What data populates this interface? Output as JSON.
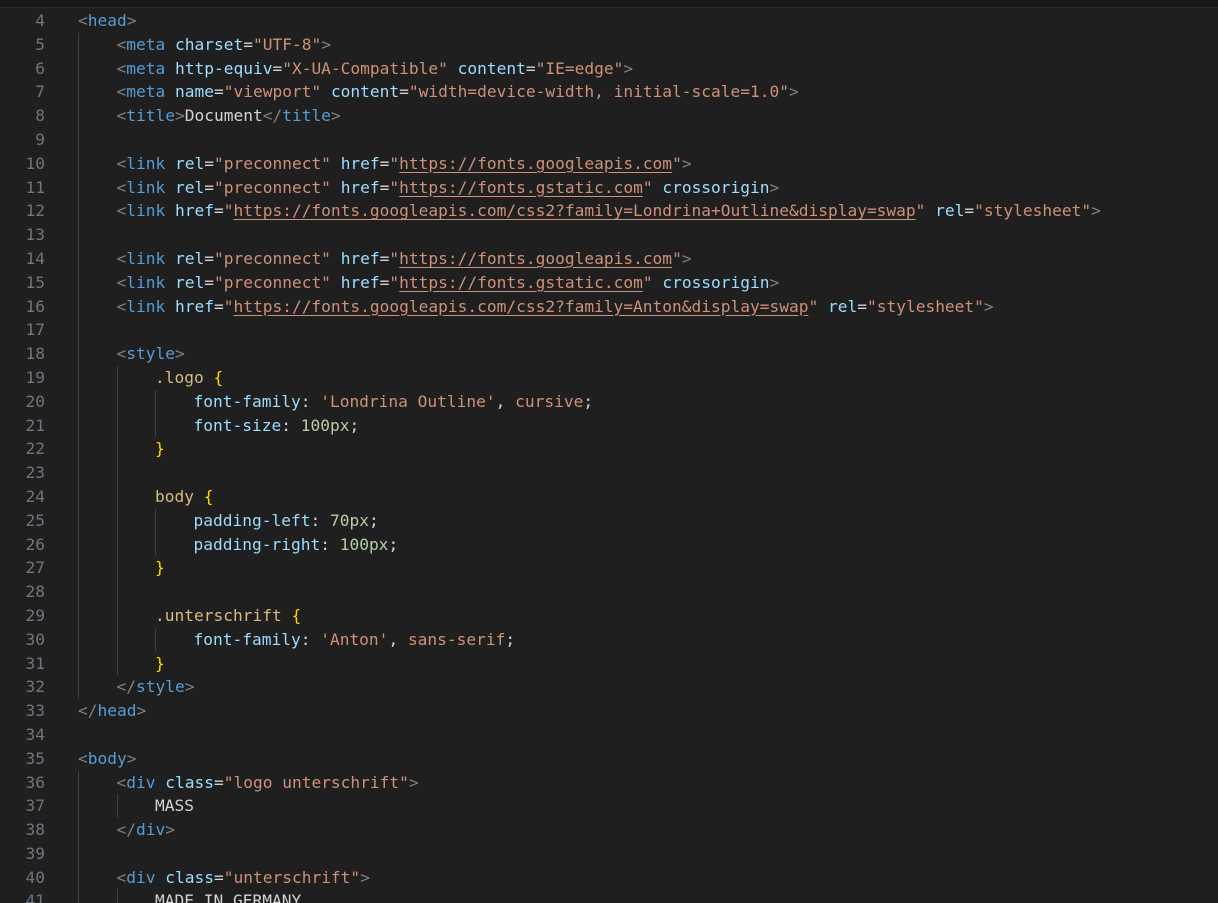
{
  "editor": {
    "language": "html",
    "lines": [
      {
        "n": "4",
        "indent": 0,
        "tokens": [
          [
            "br",
            "<"
          ],
          [
            "tag",
            "head"
          ],
          [
            "br",
            ">"
          ]
        ]
      },
      {
        "n": "5",
        "indent": 1,
        "tokens": [
          [
            "br",
            "<"
          ],
          [
            "tag",
            "meta"
          ],
          [
            "p",
            " "
          ],
          [
            "attr",
            "charset"
          ],
          [
            "p",
            "="
          ],
          [
            "str",
            "\"UTF-8\""
          ],
          [
            "br",
            ">"
          ]
        ]
      },
      {
        "n": "6",
        "indent": 1,
        "tokens": [
          [
            "br",
            "<"
          ],
          [
            "tag",
            "meta"
          ],
          [
            "p",
            " "
          ],
          [
            "attr",
            "http-equiv"
          ],
          [
            "p",
            "="
          ],
          [
            "str",
            "\"X-UA-Compatible\""
          ],
          [
            "p",
            " "
          ],
          [
            "attr",
            "content"
          ],
          [
            "p",
            "="
          ],
          [
            "str",
            "\"IE=edge\""
          ],
          [
            "br",
            ">"
          ]
        ]
      },
      {
        "n": "7",
        "indent": 1,
        "tokens": [
          [
            "br",
            "<"
          ],
          [
            "tag",
            "meta"
          ],
          [
            "p",
            " "
          ],
          [
            "attr",
            "name"
          ],
          [
            "p",
            "="
          ],
          [
            "str",
            "\"viewport\""
          ],
          [
            "p",
            " "
          ],
          [
            "attr",
            "content"
          ],
          [
            "p",
            "="
          ],
          [
            "str",
            "\"width=device-width, initial-scale=1.0\""
          ],
          [
            "br",
            ">"
          ]
        ]
      },
      {
        "n": "8",
        "indent": 1,
        "tokens": [
          [
            "br",
            "<"
          ],
          [
            "tag",
            "title"
          ],
          [
            "br",
            ">"
          ],
          [
            "txt",
            "Document"
          ],
          [
            "br",
            "</"
          ],
          [
            "tag",
            "title"
          ],
          [
            "br",
            ">"
          ]
        ]
      },
      {
        "n": "9",
        "indent": 1,
        "tokens": []
      },
      {
        "n": "10",
        "indent": 1,
        "tokens": [
          [
            "br",
            "<"
          ],
          [
            "tag",
            "link"
          ],
          [
            "p",
            " "
          ],
          [
            "attr",
            "rel"
          ],
          [
            "p",
            "="
          ],
          [
            "str",
            "\"preconnect\""
          ],
          [
            "p",
            " "
          ],
          [
            "attr",
            "href"
          ],
          [
            "p",
            "="
          ],
          [
            "str",
            "\""
          ],
          [
            "url",
            "https://fonts.googleapis.com"
          ],
          [
            "str",
            "\""
          ],
          [
            "br",
            ">"
          ]
        ]
      },
      {
        "n": "11",
        "indent": 1,
        "tokens": [
          [
            "br",
            "<"
          ],
          [
            "tag",
            "link"
          ],
          [
            "p",
            " "
          ],
          [
            "attr",
            "rel"
          ],
          [
            "p",
            "="
          ],
          [
            "str",
            "\"preconnect\""
          ],
          [
            "p",
            " "
          ],
          [
            "attr",
            "href"
          ],
          [
            "p",
            "="
          ],
          [
            "str",
            "\""
          ],
          [
            "url",
            "https://fonts.gstatic.com"
          ],
          [
            "str",
            "\""
          ],
          [
            "p",
            " "
          ],
          [
            "attr",
            "crossorigin"
          ],
          [
            "br",
            ">"
          ]
        ]
      },
      {
        "n": "12",
        "indent": 1,
        "tokens": [
          [
            "br",
            "<"
          ],
          [
            "tag",
            "link"
          ],
          [
            "p",
            " "
          ],
          [
            "attr",
            "href"
          ],
          [
            "p",
            "="
          ],
          [
            "str",
            "\""
          ],
          [
            "url",
            "https://fonts.googleapis.com/css2?family=Londrina+Outline&display=swap"
          ],
          [
            "str",
            "\""
          ],
          [
            "p",
            " "
          ],
          [
            "attr",
            "rel"
          ],
          [
            "p",
            "="
          ],
          [
            "str",
            "\"stylesheet\""
          ],
          [
            "br",
            ">"
          ]
        ]
      },
      {
        "n": "13",
        "indent": 1,
        "tokens": []
      },
      {
        "n": "14",
        "indent": 1,
        "tokens": [
          [
            "br",
            "<"
          ],
          [
            "tag",
            "link"
          ],
          [
            "p",
            " "
          ],
          [
            "attr",
            "rel"
          ],
          [
            "p",
            "="
          ],
          [
            "str",
            "\"preconnect\""
          ],
          [
            "p",
            " "
          ],
          [
            "attr",
            "href"
          ],
          [
            "p",
            "="
          ],
          [
            "str",
            "\""
          ],
          [
            "url",
            "https://fonts.googleapis.com"
          ],
          [
            "str",
            "\""
          ],
          [
            "br",
            ">"
          ]
        ]
      },
      {
        "n": "15",
        "indent": 1,
        "tokens": [
          [
            "br",
            "<"
          ],
          [
            "tag",
            "link"
          ],
          [
            "p",
            " "
          ],
          [
            "attr",
            "rel"
          ],
          [
            "p",
            "="
          ],
          [
            "str",
            "\"preconnect\""
          ],
          [
            "p",
            " "
          ],
          [
            "attr",
            "href"
          ],
          [
            "p",
            "="
          ],
          [
            "str",
            "\""
          ],
          [
            "url",
            "https://fonts.gstatic.com"
          ],
          [
            "str",
            "\""
          ],
          [
            "p",
            " "
          ],
          [
            "attr",
            "crossorigin"
          ],
          [
            "br",
            ">"
          ]
        ]
      },
      {
        "n": "16",
        "indent": 1,
        "tokens": [
          [
            "br",
            "<"
          ],
          [
            "tag",
            "link"
          ],
          [
            "p",
            " "
          ],
          [
            "attr",
            "href"
          ],
          [
            "p",
            "="
          ],
          [
            "str",
            "\""
          ],
          [
            "url",
            "https://fonts.googleapis.com/css2?family=Anton&display=swap"
          ],
          [
            "str",
            "\""
          ],
          [
            "p",
            " "
          ],
          [
            "attr",
            "rel"
          ],
          [
            "p",
            "="
          ],
          [
            "str",
            "\"stylesheet\""
          ],
          [
            "br",
            ">"
          ]
        ]
      },
      {
        "n": "17",
        "indent": 1,
        "tokens": []
      },
      {
        "n": "18",
        "indent": 1,
        "tokens": [
          [
            "br",
            "<"
          ],
          [
            "tag",
            "style"
          ],
          [
            "br",
            ">"
          ]
        ]
      },
      {
        "n": "19",
        "indent": 2,
        "tokens": [
          [
            "sel",
            ".logo"
          ],
          [
            "p",
            " "
          ],
          [
            "brace",
            "{"
          ]
        ]
      },
      {
        "n": "20",
        "indent": 3,
        "tokens": [
          [
            "prop",
            "font-family"
          ],
          [
            "p",
            ": "
          ],
          [
            "val",
            "'Londrina Outline'"
          ],
          [
            "p",
            ", "
          ],
          [
            "val",
            "cursive"
          ],
          [
            "p",
            ";"
          ]
        ]
      },
      {
        "n": "21",
        "indent": 3,
        "tokens": [
          [
            "prop",
            "font-size"
          ],
          [
            "p",
            ": "
          ],
          [
            "num",
            "100px"
          ],
          [
            "p",
            ";"
          ]
        ]
      },
      {
        "n": "22",
        "indent": 2,
        "tokens": [
          [
            "brace",
            "}"
          ]
        ]
      },
      {
        "n": "23",
        "indent": 2,
        "tokens": []
      },
      {
        "n": "24",
        "indent": 2,
        "tokens": [
          [
            "sel",
            "body"
          ],
          [
            "p",
            " "
          ],
          [
            "brace",
            "{"
          ]
        ]
      },
      {
        "n": "25",
        "indent": 3,
        "tokens": [
          [
            "prop",
            "padding-left"
          ],
          [
            "p",
            ": "
          ],
          [
            "num",
            "70px"
          ],
          [
            "p",
            ";"
          ]
        ]
      },
      {
        "n": "26",
        "indent": 3,
        "tokens": [
          [
            "prop",
            "padding-right"
          ],
          [
            "p",
            ": "
          ],
          [
            "num",
            "100px"
          ],
          [
            "p",
            ";"
          ]
        ]
      },
      {
        "n": "27",
        "indent": 2,
        "tokens": [
          [
            "brace",
            "}"
          ]
        ]
      },
      {
        "n": "28",
        "indent": 2,
        "tokens": []
      },
      {
        "n": "29",
        "indent": 2,
        "tokens": [
          [
            "sel",
            ".unterschrift"
          ],
          [
            "p",
            " "
          ],
          [
            "brace",
            "{"
          ]
        ]
      },
      {
        "n": "30",
        "indent": 3,
        "tokens": [
          [
            "prop",
            "font-family"
          ],
          [
            "p",
            ": "
          ],
          [
            "val",
            "'Anton'"
          ],
          [
            "p",
            ", "
          ],
          [
            "val",
            "sans-serif"
          ],
          [
            "p",
            ";"
          ]
        ]
      },
      {
        "n": "31",
        "indent": 2,
        "tokens": [
          [
            "brace",
            "}"
          ]
        ]
      },
      {
        "n": "32",
        "indent": 1,
        "tokens": [
          [
            "br",
            "</"
          ],
          [
            "tag",
            "style"
          ],
          [
            "br",
            ">"
          ]
        ]
      },
      {
        "n": "33",
        "indent": 0,
        "tokens": [
          [
            "br",
            "</"
          ],
          [
            "tag",
            "head"
          ],
          [
            "br",
            ">"
          ]
        ]
      },
      {
        "n": "34",
        "indent": 0,
        "tokens": []
      },
      {
        "n": "35",
        "indent": 0,
        "tokens": [
          [
            "br",
            "<"
          ],
          [
            "tag",
            "body"
          ],
          [
            "br",
            ">"
          ]
        ]
      },
      {
        "n": "36",
        "indent": 1,
        "tokens": [
          [
            "br",
            "<"
          ],
          [
            "tag",
            "div"
          ],
          [
            "p",
            " "
          ],
          [
            "attr",
            "class"
          ],
          [
            "p",
            "="
          ],
          [
            "str",
            "\"logo unterschrift\""
          ],
          [
            "br",
            ">"
          ]
        ]
      },
      {
        "n": "37",
        "indent": 2,
        "tokens": [
          [
            "txt",
            "MASS"
          ]
        ]
      },
      {
        "n": "38",
        "indent": 1,
        "tokens": [
          [
            "br",
            "</"
          ],
          [
            "tag",
            "div"
          ],
          [
            "br",
            ">"
          ]
        ]
      },
      {
        "n": "39",
        "indent": 1,
        "tokens": []
      },
      {
        "n": "40",
        "indent": 1,
        "tokens": [
          [
            "br",
            "<"
          ],
          [
            "tag",
            "div"
          ],
          [
            "p",
            " "
          ],
          [
            "attr",
            "class"
          ],
          [
            "p",
            "="
          ],
          [
            "str",
            "\"unterschrift\""
          ],
          [
            "br",
            ">"
          ]
        ]
      },
      {
        "n": "41",
        "indent": 2,
        "tokens": [
          [
            "txt",
            "MADE IN GERMANY"
          ]
        ]
      }
    ],
    "colors": {
      "background": "#1f1f1f",
      "line_number": "#6e7681",
      "tag": "#569cd6",
      "attribute": "#9cdcfe",
      "string": "#ce9178",
      "selector": "#d7ba7d",
      "brace": "#ffd700",
      "number": "#b5cea8"
    }
  }
}
